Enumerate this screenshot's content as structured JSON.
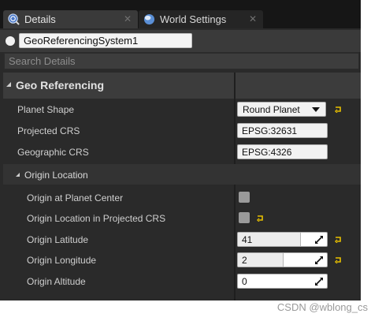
{
  "tabs": [
    {
      "label": "Details",
      "icon": "details-icon",
      "active": true
    },
    {
      "label": "World Settings",
      "icon": "world-globe-icon",
      "active": false
    }
  ],
  "object": {
    "name": "GeoReferencingSystem1"
  },
  "search": {
    "placeholder": "Search Details"
  },
  "category": {
    "label": "Geo Referencing"
  },
  "properties": {
    "planet_shape": {
      "label": "Planet Shape",
      "value": "Round Planet"
    },
    "projected_crs": {
      "label": "Projected CRS",
      "value": "EPSG:32631"
    },
    "geographic_crs": {
      "label": "Geographic CRS",
      "value": "EPSG:4326"
    }
  },
  "subcategory": {
    "label": "Origin Location"
  },
  "origin": {
    "at_planet_center": {
      "label": "Origin at Planet Center",
      "checked": false
    },
    "in_projected_crs": {
      "label": "Origin Location in Projected CRS",
      "checked": false
    },
    "latitude": {
      "label": "Origin Latitude",
      "value": "41",
      "slider_fraction": 0.7
    },
    "longitude": {
      "label": "Origin Longitude",
      "value": "2",
      "slider_fraction": 0.5
    },
    "altitude": {
      "label": "Origin Altitude",
      "value": "0",
      "slider_fraction": 0
    }
  },
  "watermark": "CSDN @wblong_cs",
  "colors": {
    "panel_bg": "#2a2a2a",
    "reset_arrow": "#e8c000",
    "field_bg": "#f2f2f2"
  }
}
